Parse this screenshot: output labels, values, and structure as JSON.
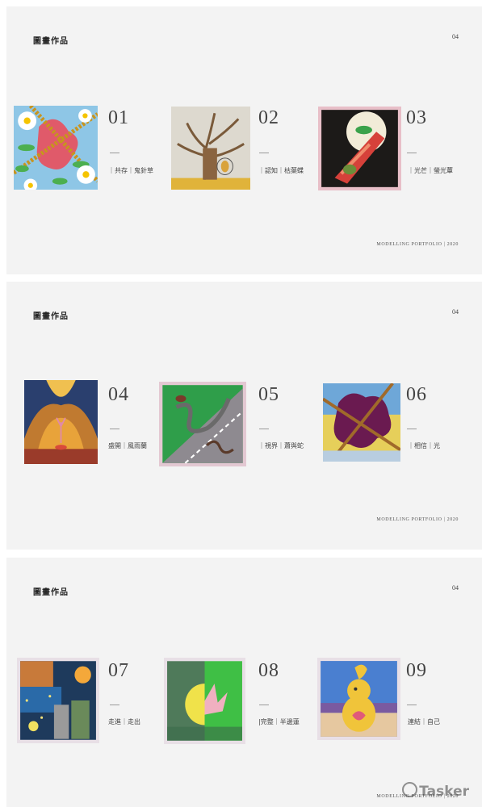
{
  "slides": [
    {
      "title": "圖畫作品",
      "page": "04",
      "footer": "MODELLING PORTFOLIO | 2020",
      "works": [
        {
          "num": "01",
          "caption": "｜共存｜鬼針草"
        },
        {
          "num": "02",
          "caption": "｜認知｜枯葉蝶"
        },
        {
          "num": "03",
          "caption": "｜光芒｜螢光蕈"
        }
      ]
    },
    {
      "title": "圖畫作品",
      "page": "04",
      "footer": "MODELLING PORTFOLIO | 2020",
      "works": [
        {
          "num": "04",
          "caption": "盛開｜風雨蘭"
        },
        {
          "num": "05",
          "caption": "｜視界｜蕭與蛇"
        },
        {
          "num": "06",
          "caption": "｜相信｜光"
        }
      ]
    },
    {
      "title": "圖畫作品",
      "page": "04",
      "footer": "MODELLING PORTFOLIO | 2020",
      "works": [
        {
          "num": "07",
          "caption": "走進｜走出"
        },
        {
          "num": "08",
          "caption": "|完整｜半邊蓮"
        },
        {
          "num": "09",
          "caption": "連結｜自己"
        }
      ]
    }
  ],
  "watermark": "Tasker"
}
